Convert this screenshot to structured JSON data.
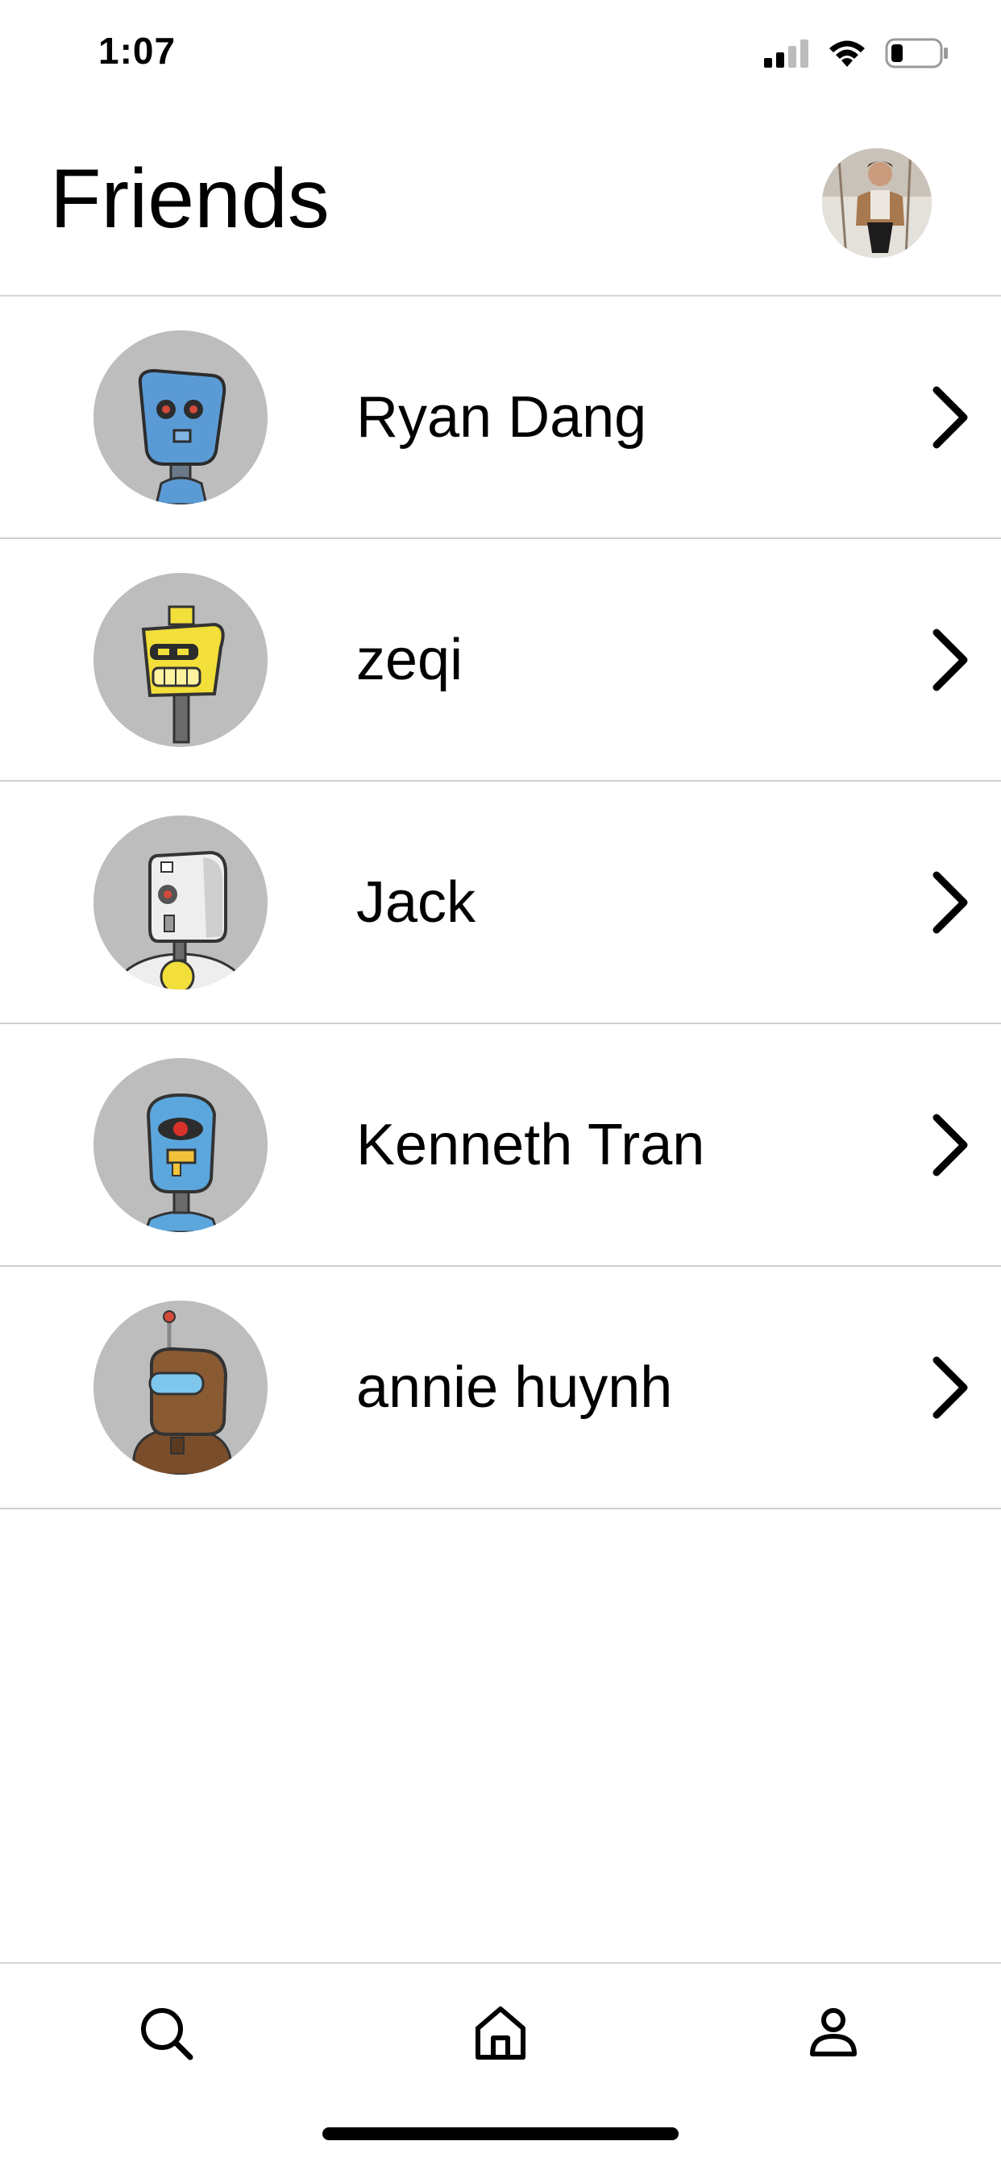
{
  "status_bar": {
    "time": "1:07",
    "icons": [
      "cellular-signal-icon",
      "wifi-icon",
      "battery-icon"
    ]
  },
  "header": {
    "title": "Friends",
    "profile_avatar": "profile-photo"
  },
  "friends": [
    {
      "name": "Ryan Dang",
      "avatar": "blue-robot-avatar",
      "avatar_color": "#5b9bd5"
    },
    {
      "name": "zeqi",
      "avatar": "yellow-robot-avatar",
      "avatar_color": "#f2df3a"
    },
    {
      "name": "Jack",
      "avatar": "white-robot-avatar",
      "avatar_color": "#eeeeee"
    },
    {
      "name": "Kenneth Tran",
      "avatar": "blue-cyclops-robot-avatar",
      "avatar_color": "#5ba7dd"
    },
    {
      "name": "annie huynh",
      "avatar": "brown-robot-avatar",
      "avatar_color": "#8a5a33"
    }
  ],
  "tab_bar": {
    "tabs": [
      "search-icon",
      "home-icon",
      "person-icon"
    ]
  },
  "colors": {
    "background": "#ffffff",
    "avatar_background": "#bdbdbd",
    "divider": "#cfcfcf",
    "text": "#000000"
  }
}
